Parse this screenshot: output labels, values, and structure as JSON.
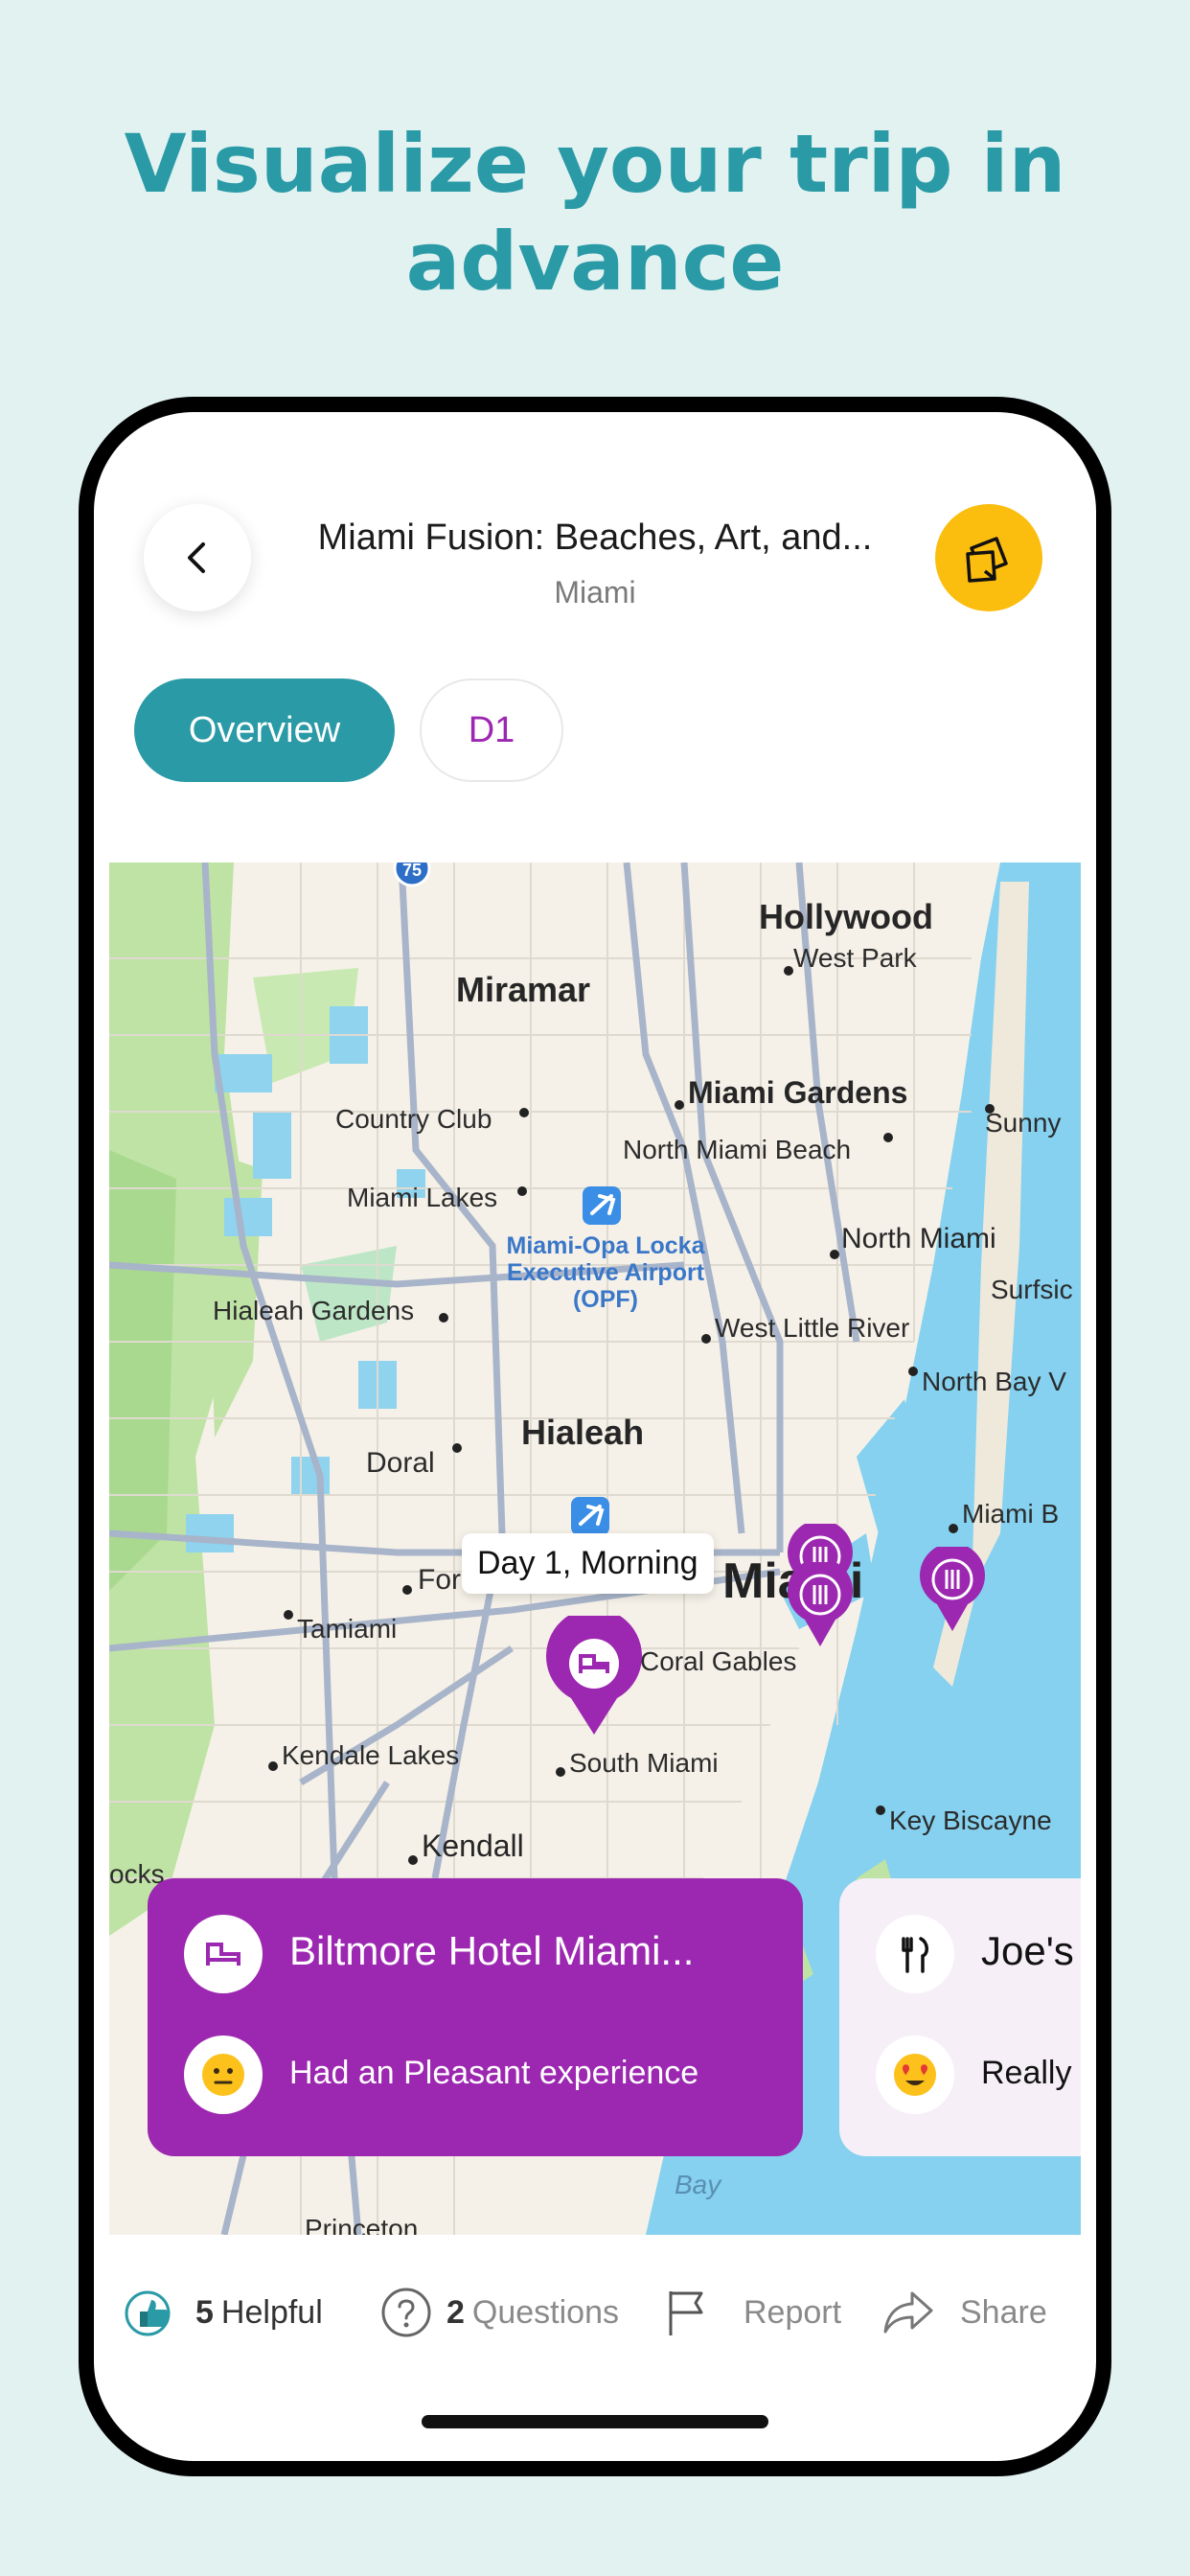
{
  "promo": {
    "headline_line1": "Visualize your trip in",
    "headline_line2": "advance"
  },
  "header": {
    "title": "Miami Fusion: Beaches, Art, and...",
    "subtitle": "Miami"
  },
  "tabs": [
    {
      "label": "Overview",
      "active": true
    },
    {
      "label": "D1",
      "active": false
    }
  ],
  "map": {
    "labels": {
      "hollywood": "Hollywood",
      "west_park": "West Park",
      "miramar": "Miramar",
      "miami_gardens": "Miami Gardens",
      "sunny": "Sunny",
      "country_club": "Country Club",
      "north_miami_beach": "North Miami Beach",
      "miami_lakes": "Miami Lakes",
      "airport": "Miami-Opa Locka Executive Airport (OPF)",
      "north_miami": "North Miami",
      "surfside": "Surfsic",
      "hialeah_gardens": "Hialeah Gardens",
      "west_little_river": "West Little River",
      "north_bay": "North Bay V",
      "doral": "Doral",
      "hialeah": "Hialeah",
      "miami_beach": "Miami B",
      "fontainebleau": "For",
      "miami": "Miami",
      "tamiami": "Tamiami",
      "coral_gables": "Coral Gables",
      "kendale_lakes": "Kendale Lakes",
      "south_miami": "South Miami",
      "key_biscayne": "Key Biscayne",
      "kendall": "Kendall",
      "cks": "ocks",
      "princeton": "Princeton",
      "bay": "Bay",
      "highway_shield": "75"
    },
    "tooltip": "Day 1, Morning"
  },
  "cards": [
    {
      "title": "Biltmore Hotel Miami...",
      "experience": "Had an Pleasant experience",
      "icon": "bed-icon",
      "mood": "neutral-face-emoji"
    },
    {
      "title": "Joe's",
      "experience": "Really",
      "icon": "fork-knife-icon",
      "mood": "heart-eyes-emoji"
    }
  ],
  "footer": {
    "helpful_count": "5",
    "helpful_label": "Helpful",
    "questions_count": "2",
    "questions_label": "Questions",
    "report_label": "Report",
    "share_label": "Share"
  },
  "colors": {
    "accent": "#2a9aa6",
    "purple": "#9c27b0",
    "yellow": "#fbbd0e",
    "background": "#e1f2f1"
  }
}
